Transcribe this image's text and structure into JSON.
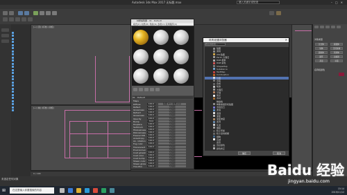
{
  "window": {
    "title": "Autodesk 3ds Max 2017    无标题.max",
    "search_placeholder": "键入关键字或短语"
  },
  "viewports": {
    "top_label": "[+] [顶] [标准] [线框]",
    "front_label": "[+] [前] [标准] [线框]"
  },
  "material_editor": {
    "title": "材质编辑器 - 01 - Default",
    "menu": "模式(D)  材质(M)  导航(N)  选项(O)  实用程序(U)",
    "material_name": "01 - Default",
    "section_label": "Maps",
    "params": [
      {
        "name": "Diffuse",
        "amount": "100.0",
        "map": "贴图 #1 (金属.jpg)"
      },
      {
        "name": "Reflect",
        "amount": "100.0",
        "map": "无贴图"
      },
      {
        "name": "Glossiness",
        "amount": "100.0",
        "map": "无贴图"
      },
      {
        "name": "Refract",
        "amount": "100.0",
        "map": "无贴图"
      },
      {
        "name": "Glossiness",
        "amount": "100.0",
        "map": "无贴图"
      },
      {
        "name": "Opacity",
        "amount": "100.0",
        "map": "无贴图"
      },
      {
        "name": "Bump",
        "amount": "30.0",
        "map": "无贴图"
      },
      {
        "name": "Displace",
        "amount": "100.0",
        "map": "无贴图"
      },
      {
        "name": "Self-illum",
        "amount": "100.0",
        "map": "无贴图"
      },
      {
        "name": "HGlossiness",
        "amount": "100.0",
        "map": "无贴图"
      },
      {
        "name": "RGlossiness",
        "amount": "100.0",
        "map": "无贴图"
      },
      {
        "name": "Fresnel IOR",
        "amount": "100.0",
        "map": "无贴图"
      },
      {
        "name": "Anisotropy",
        "amount": "100.0",
        "map": "无贴图"
      },
      {
        "name": "An. rotation",
        "amount": "100.0",
        "map": "无贴图"
      },
      {
        "name": "Fog color",
        "amount": "100.0",
        "map": "无贴图"
      },
      {
        "name": "Translucent",
        "amount": "100.0",
        "map": "无贴图"
      },
      {
        "name": "Environment",
        "amount": "",
        "map": "无贴图"
      },
      {
        "name": "Coat glossiness",
        "amount": "100.0",
        "map": "无贴图"
      },
      {
        "name": "Coat color",
        "amount": "100.0",
        "map": "无贴图"
      },
      {
        "name": "Coat bump",
        "amount": "100.0",
        "map": "无贴图"
      },
      {
        "name": "Sheen color",
        "amount": "100.0",
        "map": "无贴图"
      },
      {
        "name": "Sheen gloss",
        "amount": "100.0",
        "map": "无贴图"
      },
      {
        "name": "Thin film",
        "amount": "100.0",
        "map": "无贴图"
      }
    ]
  },
  "browser_dialog": {
    "title": "材质/贴图浏览器",
    "search_placeholder": "按名称搜索...",
    "items": [
      {
        "label": "贴图",
        "color": "#888888"
      },
      {
        "label": "通用",
        "color": "#888888"
      },
      {
        "label": "OSL贴图",
        "color": "#c9a24a"
      },
      {
        "label": "Perlin 大理石",
        "color": "#999999"
      },
      {
        "label": "RGB 相乘",
        "color": "#aaaaaa"
      },
      {
        "label": "RGB 染色",
        "color": "#cc5555"
      },
      {
        "label": "ShapeMap",
        "color": "#7a7a7a"
      },
      {
        "label": "Substance",
        "color": "#6fa0c8"
      },
      {
        "label": "TextMap",
        "color": "#c04040"
      },
      {
        "label": "Combustion",
        "color": "#c06020"
      },
      {
        "label": "位图",
        "color": "#d8d8d8",
        "selected": true
      },
      {
        "label": "凹痕",
        "color": "#777777"
      },
      {
        "label": "合成",
        "color": "#666666"
      },
      {
        "label": "噪波",
        "color": "#bbbbbb"
      },
      {
        "label": "大理石",
        "color": "#999999"
      },
      {
        "label": "平铺",
        "color": "#b08060"
      },
      {
        "label": "斑点",
        "color": "#eeeeee"
      },
      {
        "label": "木材",
        "color": "#a06a30"
      },
      {
        "label": "棋盘格",
        "color": "#222222"
      },
      {
        "label": "每像素摄影机贴图",
        "color": "#888888"
      },
      {
        "label": "法线凹凸",
        "color": "#7777cc"
      },
      {
        "label": "波浪",
        "color": "#5588bb"
      },
      {
        "label": "泼溅",
        "color": "#dddddd"
      },
      {
        "label": "渐变",
        "color": "#bbbbbb"
      },
      {
        "label": "渐变坡度",
        "color": "#aa8866"
      },
      {
        "label": "漩涡",
        "color": "#6688aa"
      },
      {
        "label": "灰泥",
        "color": "#cccccc"
      },
      {
        "label": "烟雾",
        "color": "#999999"
      },
      {
        "label": "粒子年龄",
        "color": "#555555"
      },
      {
        "label": "粒子运动模糊",
        "color": "#666666"
      },
      {
        "label": "细胞",
        "color": "#446688"
      },
      {
        "label": "衰减",
        "color": "#f0f0f0"
      },
      {
        "label": "遮罩",
        "color": "#333333"
      },
      {
        "label": "顶点颜色",
        "color": "#777777"
      },
      {
        "label": "颜色修正",
        "color": "#aaaaaa"
      }
    ],
    "ok_label": "确定",
    "cancel_label": "取消"
  },
  "command_panel": {
    "section1": "对象类型",
    "section2": "名称和颜色",
    "buttons": [
      "长方体",
      "圆锥体",
      "球体",
      "几何球体",
      "圆柱体",
      "管状体",
      "圆环",
      "四棱锥",
      "茶壶",
      "平面"
    ]
  },
  "status": {
    "text": "未选定任何对象",
    "frame": "0 / 100"
  },
  "taskbar": {
    "search_text": "在这里输入你要搜索的内容",
    "time": "15:14",
    "date": "2019/11/12"
  },
  "watermark": {
    "brand": "Baidu 经验",
    "url": "jingyan.baidu.com"
  },
  "colors": {
    "accent": "#5272b0",
    "wireframe": "#c86ea8",
    "gold": "#e6b422"
  }
}
